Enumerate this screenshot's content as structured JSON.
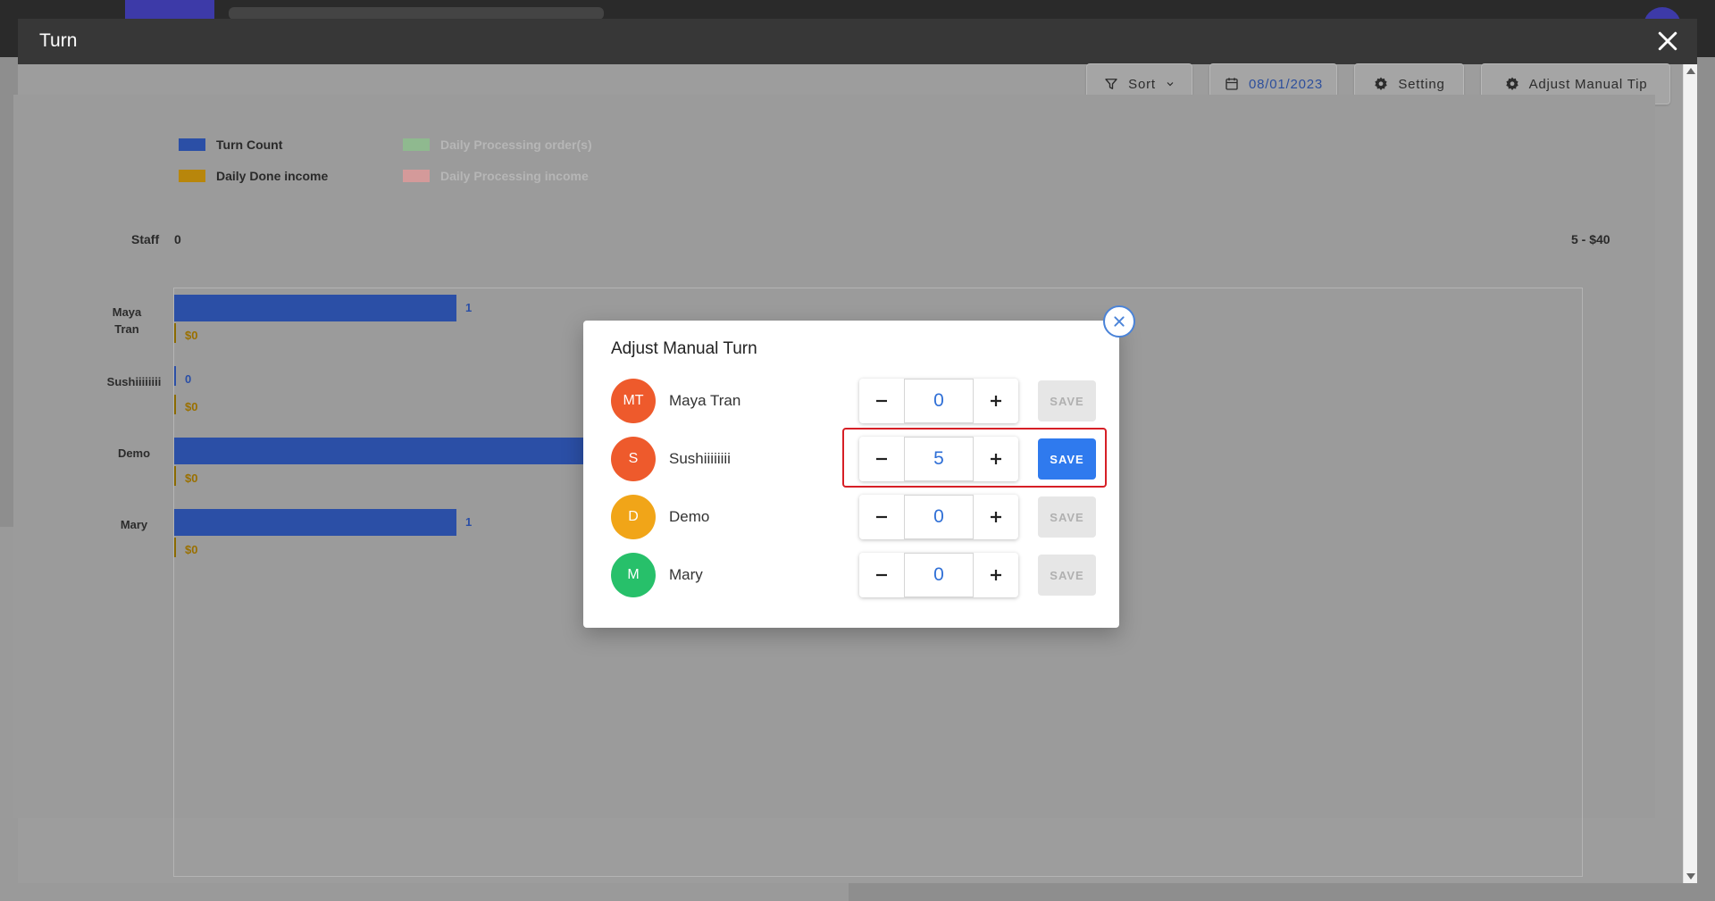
{
  "window": {
    "title": "Turn"
  },
  "toolbar": {
    "sort_label": "Sort",
    "date_label": "08/01/2023",
    "setting_label": "Setting",
    "adjust_tip_label": "Adjust Manual Tip"
  },
  "legend": [
    {
      "label": "Turn Count",
      "color": "#2b4fa6",
      "faded": false
    },
    {
      "label": "Daily Processing order(s)",
      "color": "#8fb98f",
      "faded": true
    },
    {
      "label": "Daily Done income",
      "color": "#b8860b",
      "faded": false
    },
    {
      "label": "Daily Processing income",
      "color": "#d49a9a",
      "faded": true
    }
  ],
  "chart_data": {
    "type": "bar",
    "orientation": "horizontal",
    "categories": [
      "Maya Tran",
      "Sushiiiiiiii",
      "Demo",
      "Mary"
    ],
    "series": [
      {
        "name": "Turn Count",
        "values": [
          1,
          0,
          null,
          1
        ],
        "value_labels": [
          "1",
          "0",
          "",
          "1"
        ]
      },
      {
        "name": "Daily Done income",
        "values": [
          0,
          0,
          0,
          0
        ],
        "value_labels": [
          "$0",
          "$0",
          "$0",
          "$0"
        ]
      }
    ],
    "axis": {
      "category_title": "Staff",
      "min_label": "0",
      "max_label": "5 - $40"
    },
    "grid": false,
    "legend_position": "top-left"
  },
  "staff_labels": [
    "Maya\nTran",
    "Sushiiiiiiii",
    "Demo",
    "Mary"
  ],
  "modal": {
    "title": "Adjust Manual Turn",
    "rows": [
      {
        "initials": "MT",
        "name": "Maya Tran",
        "color": "#ee5a2c",
        "value": "0",
        "save_label": "SAVE",
        "save_active": false
      },
      {
        "initials": "S",
        "name": "Sushiiiiiiii",
        "color": "#ee5a2c",
        "value": "5",
        "save_label": "SAVE",
        "save_active": true
      },
      {
        "initials": "D",
        "name": "Demo",
        "color": "#f1a518",
        "value": "0",
        "save_label": "SAVE",
        "save_active": false
      },
      {
        "initials": "M",
        "name": "Mary",
        "color": "#27c06a",
        "value": "0",
        "save_label": "SAVE",
        "save_active": false
      }
    ]
  }
}
